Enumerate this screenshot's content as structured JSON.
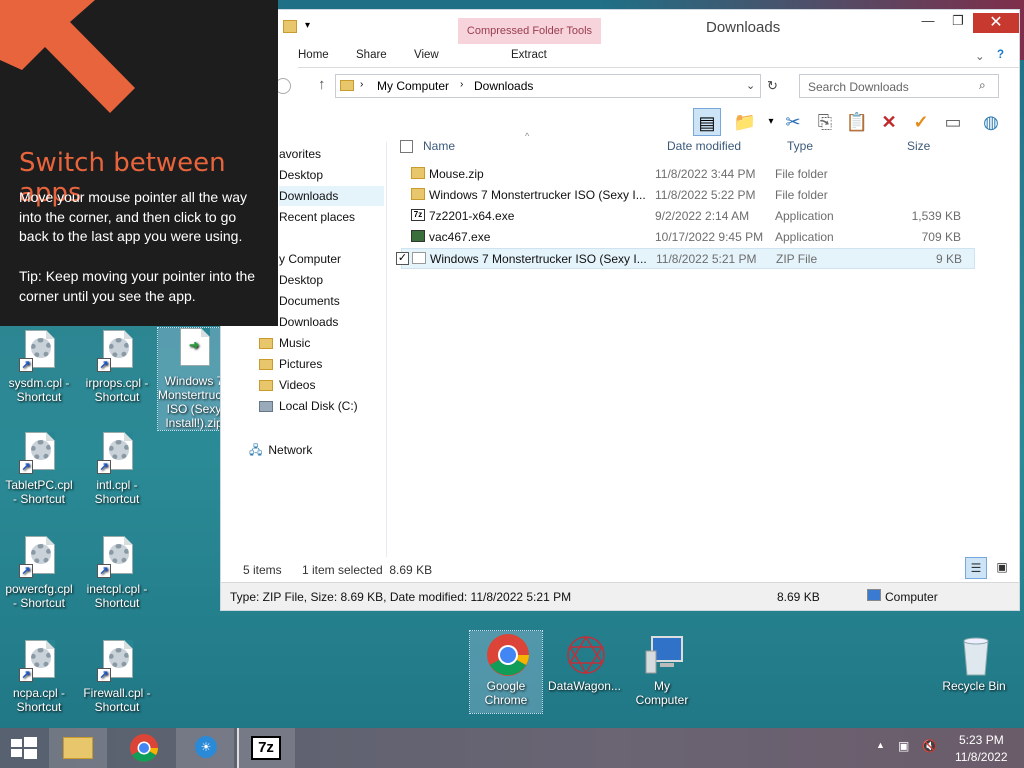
{
  "charm": {
    "heading": "Switch between apps",
    "body": "Move your mouse pointer all the way into the corner, and then click to go back to the last app you were using.",
    "tip": "Tip: Keep moving your pointer into the corner until you see the app.",
    "accent_color": "#e8643c"
  },
  "desktop_icons": [
    {
      "label": "sysdm.cpl - Shortcut",
      "icon": "control-panel-icon"
    },
    {
      "label": "irprops.cpl - Shortcut",
      "icon": "control-panel-icon"
    },
    {
      "label": "Windows 7 Monstertrucker ISO (Sexy Install!).zip",
      "icon": "zip-icon"
    },
    {
      "label": "TabletPC.cpl - Shortcut",
      "icon": "control-panel-icon"
    },
    {
      "label": "intl.cpl - Shortcut",
      "icon": "control-panel-icon"
    },
    {
      "label": "powercfg.cpl - Shortcut",
      "icon": "control-panel-icon"
    },
    {
      "label": "inetcpl.cpl - Shortcut",
      "icon": "control-panel-icon"
    },
    {
      "label": "ncpa.cpl - Shortcut",
      "icon": "control-panel-icon"
    },
    {
      "label": "Firewall.cpl - Shortcut",
      "icon": "control-panel-icon"
    },
    {
      "label": "Google Chrome",
      "icon": "chrome-icon"
    },
    {
      "label": "DataWagon...",
      "icon": "datawagon-icon"
    },
    {
      "label": "My Computer",
      "icon": "computer-icon"
    },
    {
      "label": "Recycle Bin",
      "icon": "recycle-bin-icon"
    }
  ],
  "window": {
    "title": "Downloads",
    "context_tab": "Compressed Folder Tools",
    "ribbon_tabs": [
      "Home",
      "Share",
      "View",
      "Extract"
    ],
    "breadcrumb": [
      "My Computer",
      "Downloads"
    ],
    "search_placeholder": "Search Downloads"
  },
  "nav": {
    "items": [
      {
        "label": "Favorites",
        "visible": "avorites"
      },
      {
        "label": "Desktop"
      },
      {
        "label": "Downloads"
      },
      {
        "label": "Recent places"
      },
      {
        "label": "My Computer",
        "visible": "y Computer"
      },
      {
        "label": "Desktop"
      },
      {
        "label": "Documents"
      },
      {
        "label": "Downloads"
      },
      {
        "label": "Music"
      },
      {
        "label": "Pictures"
      },
      {
        "label": "Videos"
      },
      {
        "label": "Local Disk (C:)"
      },
      {
        "label": "Network"
      }
    ]
  },
  "files": {
    "columns": [
      "Name",
      "Date modified",
      "Type",
      "Size"
    ],
    "rows": [
      {
        "name": "Mouse.zip",
        "date": "11/8/2022 3:44 PM",
        "type": "File folder",
        "size": ""
      },
      {
        "name": "Windows 7 Monstertrucker ISO (Sexy I...",
        "date": "11/8/2022 5:22 PM",
        "type": "File folder",
        "size": ""
      },
      {
        "name": "7z2201-x64.exe",
        "date": "9/2/2022 2:14 AM",
        "type": "Application",
        "size": "1,539 KB"
      },
      {
        "name": "vac467.exe",
        "date": "10/17/2022 9:45 PM",
        "type": "Application",
        "size": "709 KB"
      },
      {
        "name": "Windows 7 Monstertrucker ISO (Sexy I...",
        "date": "11/8/2022 5:21 PM",
        "type": "ZIP File",
        "size": "9 KB"
      }
    ]
  },
  "status": {
    "items": "5 items",
    "selected": "1 item selected  8.69 KB",
    "details": "Type: ZIP File, Size: 8.69 KB, Date modified: 11/8/2022 5:21 PM",
    "size": "8.69 KB",
    "location": "Computer"
  },
  "taskbar": {
    "time": "5:23 PM",
    "date": "11/8/2022",
    "apps": [
      "file-explorer-icon",
      "chrome-icon",
      "weather-icon",
      "7zip-icon"
    ]
  }
}
